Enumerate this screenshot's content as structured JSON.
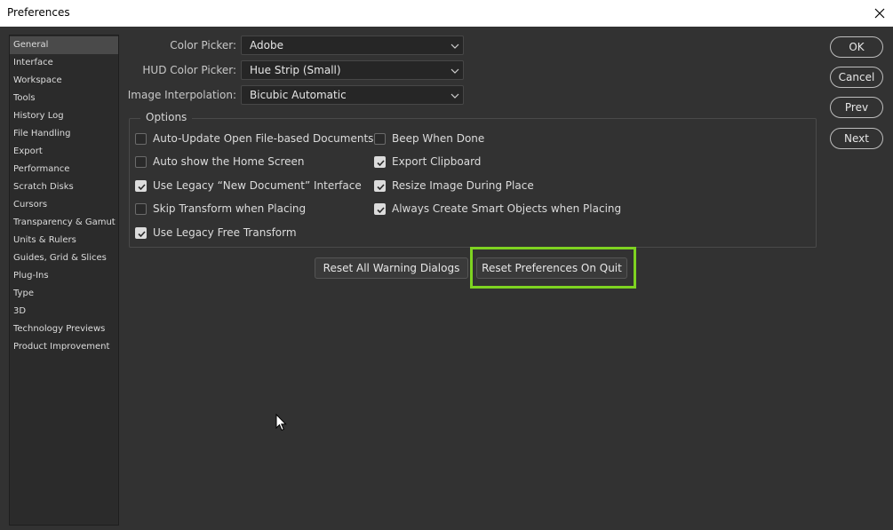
{
  "window": {
    "title": "Preferences"
  },
  "sidebar": {
    "items": [
      {
        "label": "General",
        "selected": true
      },
      {
        "label": "Interface"
      },
      {
        "label": "Workspace"
      },
      {
        "label": "Tools"
      },
      {
        "label": "History Log"
      },
      {
        "label": "File Handling"
      },
      {
        "label": "Export"
      },
      {
        "label": "Performance"
      },
      {
        "label": "Scratch Disks"
      },
      {
        "label": "Cursors"
      },
      {
        "label": "Transparency & Gamut"
      },
      {
        "label": "Units & Rulers"
      },
      {
        "label": "Guides, Grid & Slices"
      },
      {
        "label": "Plug-Ins"
      },
      {
        "label": "Type"
      },
      {
        "label": "3D"
      },
      {
        "label": "Technology Previews"
      },
      {
        "label": "Product Improvement"
      }
    ]
  },
  "fields": {
    "color_picker": {
      "label": "Color Picker:",
      "value": "Adobe"
    },
    "hud_color_picker": {
      "label": "HUD Color Picker:",
      "value": "Hue Strip (Small)"
    },
    "image_interpolation": {
      "label": "Image Interpolation:",
      "value": "Bicubic Automatic"
    }
  },
  "options": {
    "legend": "Options",
    "left": [
      {
        "label": "Auto-Update Open File-based Documents",
        "checked": false
      },
      {
        "label": "Auto show the Home Screen",
        "checked": false
      },
      {
        "label": "Use Legacy “New Document” Interface",
        "checked": true
      },
      {
        "label": "Skip Transform when Placing",
        "checked": false
      },
      {
        "label": "Use Legacy Free Transform",
        "checked": true
      }
    ],
    "right": [
      {
        "label": "Beep When Done",
        "checked": false
      },
      {
        "label": "Export Clipboard",
        "checked": true
      },
      {
        "label": "Resize Image During Place",
        "checked": true
      },
      {
        "label": "Always Create Smart Objects when Placing",
        "checked": true
      }
    ]
  },
  "buttons": {
    "reset_warnings": "Reset All Warning Dialogs",
    "reset_prefs": "Reset Preferences On Quit",
    "ok": "OK",
    "cancel": "Cancel",
    "prev": "Prev",
    "next": "Next"
  },
  "colors": {
    "highlight": "#7ed321",
    "background": "#323232"
  }
}
